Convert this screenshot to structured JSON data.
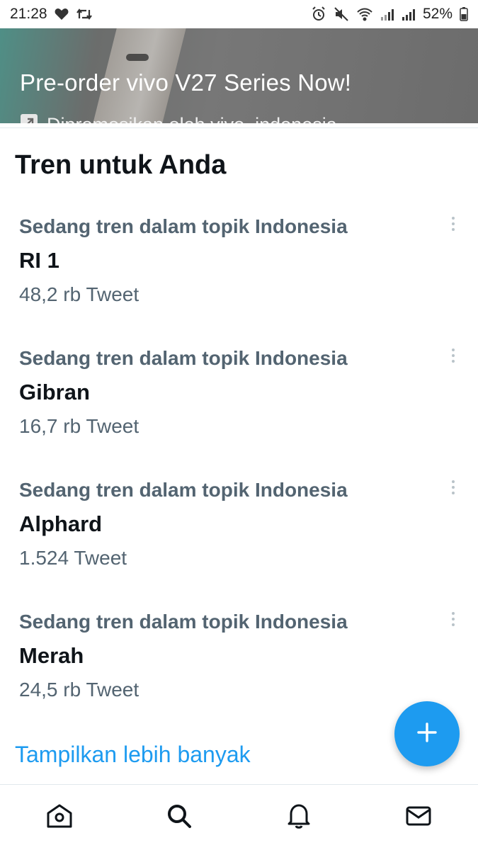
{
  "status_bar": {
    "time": "21:28",
    "battery": "52%",
    "icons": [
      "heart-icon",
      "retweet-icon",
      "alarm-icon",
      "mute-icon",
      "wifi-icon",
      "signal-icon",
      "signal-icon",
      "battery-icon"
    ]
  },
  "promo": {
    "title": "Pre-order vivo V27 Series Now!",
    "promoted_by": "Dipromosikan oleh vivo_indonesia"
  },
  "trends": {
    "title": "Tren untuk Anda",
    "items": [
      {
        "context": "Sedang tren dalam topik Indonesia",
        "name": "RI 1",
        "count": "48,2 rb Tweet"
      },
      {
        "context": "Sedang tren dalam topik Indonesia",
        "name": "Gibran",
        "count": "16,7 rb Tweet"
      },
      {
        "context": "Sedang tren dalam topik Indonesia",
        "name": "Alphard",
        "count": "1.524 Tweet"
      },
      {
        "context": "Sedang tren dalam topik Indonesia",
        "name": "Merah",
        "count": "24,5 rb Tweet"
      }
    ],
    "show_more": "Tampilkan lebih banyak"
  },
  "fab": {
    "icon": "plus-icon",
    "color": "#1d9bf0"
  },
  "bottom_nav": [
    "home-icon",
    "search-icon",
    "notifications-icon",
    "messages-icon"
  ],
  "colors": {
    "accent": "#1d9bf0",
    "secondary_text": "#536471",
    "primary_text": "#0f1419"
  }
}
